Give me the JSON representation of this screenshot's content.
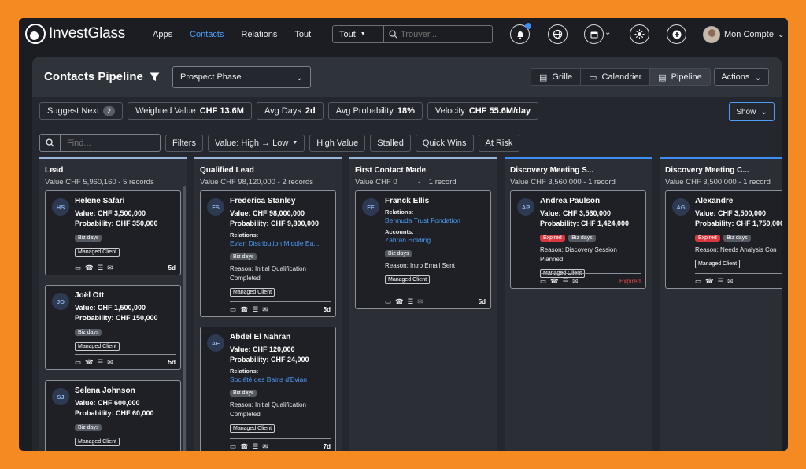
{
  "app": {
    "brand": "InvestGlass"
  },
  "nav": [
    "Apps",
    "Contacts",
    "Relations",
    "Tout"
  ],
  "top_search": {
    "scope": "Tout",
    "placeholder": "Trouver..."
  },
  "account": {
    "label": "Mon Compte"
  },
  "header": {
    "title": "Contacts Pipeline",
    "phase": "Prospect Phase",
    "views": [
      "Grille",
      "Calendrier",
      "Pipeline"
    ],
    "actions": "Actions"
  },
  "stats": {
    "suggest": {
      "label": "Suggest Next",
      "count": "2"
    },
    "weighted": {
      "label": "Weighted Value",
      "value": "CHF 13.6M"
    },
    "avg_days": {
      "label": "Avg Days",
      "value": "2d"
    },
    "avg_prob": {
      "label": "Avg Probability",
      "value": "18%"
    },
    "velocity": {
      "label": "Velocity",
      "value": "CHF 55.6M/day"
    },
    "show": "Show"
  },
  "filters": {
    "placeholder": "Find...",
    "buttons": [
      "Filters",
      "Value: High → Low",
      "High Value",
      "Stalled",
      "Quick Wins",
      "At Risk"
    ]
  },
  "colors": {
    "accent": "#4d9df7",
    "danger": "#d9363e",
    "background": "#f58a23"
  },
  "icons": [
    "bell-icon",
    "globe-icon",
    "calendar-icon",
    "sun-icon",
    "plus-icon",
    "filter-icon",
    "search-icon",
    "grid-icon",
    "list-icon",
    "chevron-down-icon"
  ],
  "columns": [
    {
      "title": "Lead",
      "sub": "Value CHF 5,960,160 -    5 records",
      "cards": [
        {
          "initials": "HS",
          "name": "Helene Safari",
          "value": "Value: CHF 3,500,000",
          "prob": "Probability: CHF 350,000",
          "tag": "Biz days",
          "mc": "Managed Client",
          "days": "5d"
        },
        {
          "initials": "JO",
          "name": "Joël Ott",
          "value": "Value: CHF 1,500,000",
          "prob": "Probability: CHF 150,000",
          "tag": "Biz days",
          "mc": "Managed Client",
          "days": "5d"
        },
        {
          "initials": "SJ",
          "name": "Selena Johnson",
          "value": "Value: CHF 600,000",
          "prob": "Probability: CHF 60,000",
          "tag": "Biz days",
          "mc": "Managed Client"
        }
      ]
    },
    {
      "title": "Qualified Lead",
      "sub": "Value CHF 98,120,000 -    2 records",
      "cards": [
        {
          "initials": "FS",
          "name": "Frederica Stanley",
          "value": "Value: CHF 98,000,000",
          "prob": "Probability: CHF 9,800,000",
          "rel_label": "Relations:",
          "rel": "Evian Distribution Middle Ea...",
          "tag": "Biz days",
          "reason": "Reason: Initial Qualification Completed",
          "mc": "Managed Client",
          "days": "5d"
        },
        {
          "initials": "AE",
          "name": "Abdel El Nahran",
          "value": "Value: CHF 120,000",
          "prob": "Probability: CHF 24,000",
          "rel_label": "Relations:",
          "rel": "Société des Bains d'Evian",
          "tag": "Biz days",
          "reason": "Reason: Initial Qualification Completed",
          "mc": "Managed Client",
          "days": "7d"
        }
      ]
    },
    {
      "title": "First Contact Made",
      "sub": "Value CHF 0          -    1 record",
      "cards": [
        {
          "initials": "FE",
          "name": "Franck Ellis",
          "rel_label": "Relations:",
          "rel": "Bermuda Trust Fondation",
          "acc_label": "Accounts:",
          "acc": "Zahran Holding",
          "tag": "Biz days",
          "reason": "Reason: Intro Email Sent",
          "mc": "Managed Client",
          "days": "5d"
        }
      ]
    },
    {
      "title": "Discovery Meeting S...",
      "sub": "Value CHF 3,560,000 -    1 record",
      "cards": [
        {
          "initials": "AP",
          "name": "Andrea Paulson",
          "value": "Value: CHF 3,560,000",
          "prob": "Probability: CHF 1,424,000",
          "tag_red": "Expired",
          "tag": "Biz days",
          "reason": "Reason: Discovery Session Planned",
          "mc": "Managed Client",
          "expired": "Expired"
        }
      ]
    },
    {
      "title": "Discovery Meeting C...",
      "sub": "Value CHF 3,500,000 -    1 record",
      "cards": [
        {
          "initials": "AG",
          "name": "Alexandre",
          "value": "Value: CHF 3,500,000",
          "prob": "Probability: CHF 1,750,000",
          "tag_red": "Expired",
          "tag": "Biz days",
          "reason": "Reason: Needs Analysis Con",
          "mc": "Managed Client"
        }
      ]
    }
  ]
}
